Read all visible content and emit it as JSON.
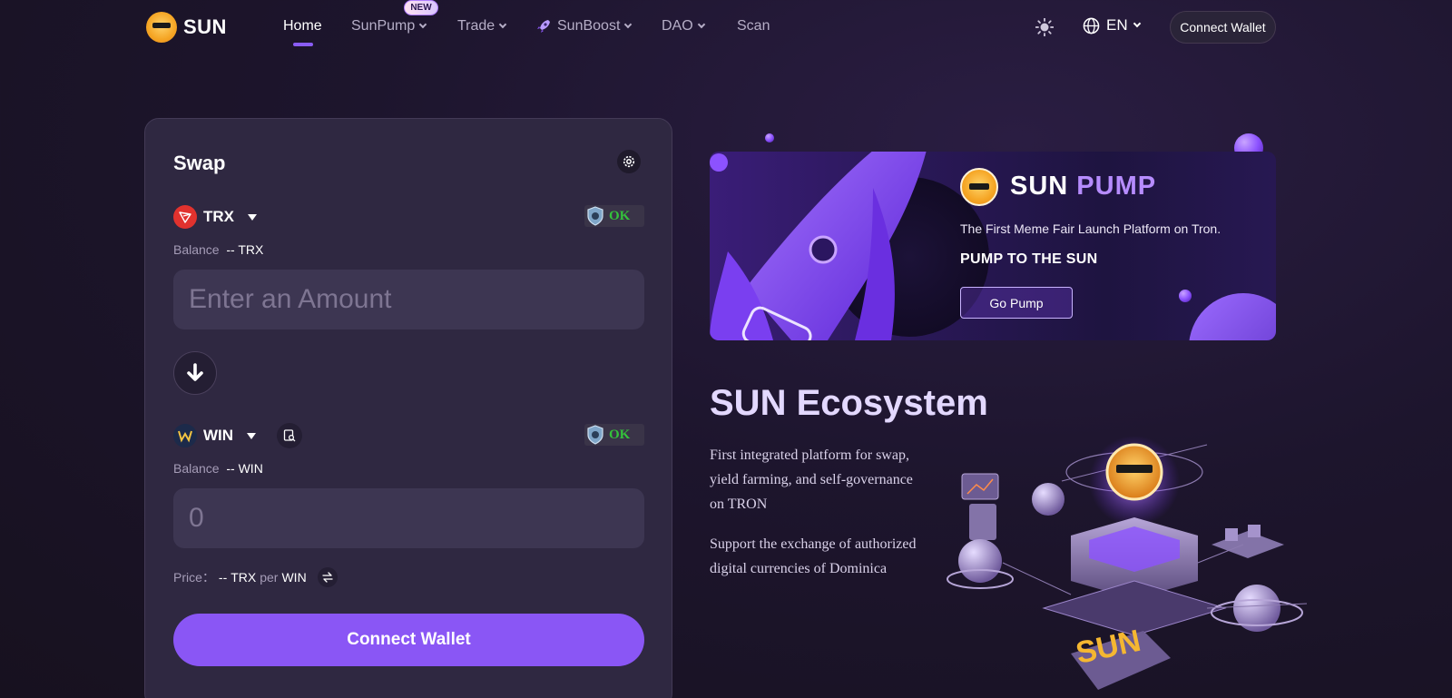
{
  "nav": {
    "brand": "SUN",
    "items": [
      {
        "label": "Home"
      },
      {
        "label": "SunPump"
      },
      {
        "label": "Trade"
      },
      {
        "label": "SunBoost"
      },
      {
        "label": "DAO"
      },
      {
        "label": "Scan"
      }
    ],
    "new_badge": "NEW",
    "language": "EN",
    "connect_wallet": "Connect Wallet"
  },
  "swap": {
    "title": "Swap",
    "from": {
      "token": "TRX",
      "ok_label": "OK",
      "balance_label": "Balance",
      "balance_value": "-- TRX",
      "amount_placeholder": "Enter an Amount"
    },
    "to": {
      "token": "WIN",
      "ok_label": "OK",
      "balance_label": "Balance",
      "balance_value": "-- WIN",
      "amount_value": "0"
    },
    "price": {
      "label": "Price：",
      "value": "--",
      "base": "TRX",
      "per": "per",
      "quote": "WIN"
    },
    "connect_wallet": "Connect Wallet"
  },
  "banner": {
    "title_part1": "SUN",
    "title_part2": "PUMP",
    "subtitle": "The First Meme Fair Launch Platform on Tron.",
    "tagline": "PUMP TO THE SUN",
    "button": "Go Pump"
  },
  "ecosystem": {
    "title": "SUN Ecosystem",
    "paragraph1": "First integrated platform for swap, yield farming, and self-governance on TRON",
    "paragraph2": "Support the exchange of authorized digital currencies of Dominica",
    "sign_text": "SUN"
  },
  "colors": {
    "accent": "#8a56f5",
    "ok_green": "#34c33b",
    "tron_red": "#e1322e",
    "background": "#1d152d"
  }
}
